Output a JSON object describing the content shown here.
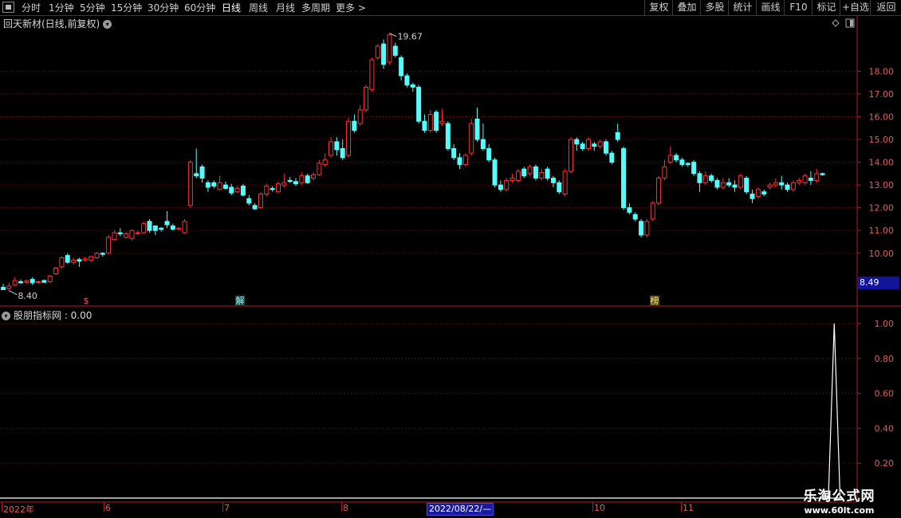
{
  "toolbar": {
    "left": [
      "分时",
      "1分钟",
      "5分钟",
      "15分钟",
      "30分钟",
      "60分钟",
      "日线",
      "周线",
      "月线",
      "多周期",
      "更多 >"
    ],
    "right": [
      "复权",
      "叠加",
      "多股",
      "统计",
      "画线",
      "F10",
      "标记",
      "+自选",
      "返回"
    ],
    "active": "日线"
  },
  "stock": {
    "title": "回天新材(日线,前复权)"
  },
  "indicator": {
    "title": "股朋指标网 : 0.00"
  },
  "price_axis": [
    "18.00",
    "17.00",
    "16.00",
    "15.00",
    "14.00",
    "13.00",
    "12.00",
    "11.00",
    "10.00"
  ],
  "indicator_axis": [
    "1.00",
    "0.80",
    "0.60",
    "0.40",
    "0.20"
  ],
  "current_price": "8.49",
  "max_label": "19.67",
  "min_label": "8.40",
  "markers": [
    "$",
    "解",
    "榜"
  ],
  "date_axis": [
    "2022年",
    "6",
    "7",
    "8",
    "10",
    "11"
  ],
  "cursor_date": "2022/08/22/—",
  "watermark": {
    "name": "乐淘公式网",
    "url": "www.60lt.com"
  },
  "colors": {
    "up": "#ff3232",
    "down": "#54fcfc",
    "grid": "#7a1010",
    "border": "#b01e1e",
    "axis_text": "#e0605a"
  },
  "chart_data": {
    "type": "candlestick",
    "ylim": [
      8.1,
      19.8
    ],
    "indicator_ylim": [
      0,
      1
    ],
    "candles": [
      [
        8.5,
        8.4,
        8.4,
        8.65
      ],
      [
        8.45,
        8.55,
        8.35,
        8.7
      ],
      [
        8.6,
        8.8,
        8.55,
        8.95
      ],
      [
        8.75,
        8.7,
        8.65,
        8.85
      ],
      [
        8.72,
        8.78,
        8.65,
        8.85
      ],
      [
        8.85,
        8.7,
        8.6,
        8.95
      ],
      [
        8.72,
        8.75,
        8.65,
        8.8
      ],
      [
        8.8,
        8.72,
        8.7,
        8.85
      ],
      [
        8.75,
        9.0,
        8.7,
        9.05
      ],
      [
        9.1,
        9.35,
        9.05,
        9.4
      ],
      [
        9.4,
        9.8,
        9.3,
        9.85
      ],
      [
        9.9,
        9.6,
        9.55,
        10.0
      ],
      [
        9.6,
        9.7,
        9.5,
        9.8
      ],
      [
        9.72,
        9.65,
        9.4,
        9.8
      ],
      [
        9.7,
        9.75,
        9.65,
        9.85
      ],
      [
        9.7,
        9.85,
        9.6,
        9.9
      ],
      [
        9.8,
        10.0,
        9.75,
        10.05
      ],
      [
        10.0,
        9.95,
        9.85,
        10.05
      ],
      [
        10.0,
        10.7,
        9.95,
        10.8
      ],
      [
        10.6,
        10.9,
        10.55,
        11.0
      ],
      [
        10.9,
        10.85,
        10.75,
        11.1
      ],
      [
        10.7,
        10.85,
        10.65,
        10.95
      ],
      [
        10.65,
        11.0,
        10.55,
        11.05
      ],
      [
        10.9,
        10.9,
        10.8,
        11.0
      ],
      [
        10.9,
        11.3,
        10.85,
        11.4
      ],
      [
        11.4,
        11.0,
        10.9,
        11.5
      ],
      [
        11.2,
        11.0,
        10.8,
        11.2
      ],
      [
        11.1,
        11.05,
        10.95,
        11.15
      ],
      [
        11.4,
        11.25,
        11.1,
        11.85
      ],
      [
        11.2,
        11.05,
        11.0,
        11.3
      ],
      [
        11.05,
        11.1,
        11.0,
        11.15
      ],
      [
        10.9,
        11.4,
        10.85,
        11.5
      ],
      [
        12.1,
        14.0,
        12.0,
        14.1
      ],
      [
        13.5,
        13.4,
        13.3,
        14.6
      ],
      [
        13.8,
        13.3,
        13.1,
        13.9
      ],
      [
        13.1,
        12.9,
        12.7,
        13.2
      ],
      [
        13.1,
        12.95,
        12.85,
        13.2
      ],
      [
        12.8,
        13.1,
        12.75,
        13.4
      ],
      [
        13.0,
        12.85,
        12.8,
        13.15
      ],
      [
        12.9,
        12.65,
        12.55,
        13.05
      ],
      [
        12.7,
        12.85,
        12.65,
        12.95
      ],
      [
        12.95,
        12.55,
        12.5,
        13.05
      ],
      [
        12.4,
        12.2,
        12.1,
        12.55
      ],
      [
        12.1,
        11.95,
        11.9,
        12.2
      ],
      [
        12.0,
        12.6,
        11.95,
        12.7
      ],
      [
        12.6,
        12.95,
        12.5,
        13.05
      ],
      [
        12.85,
        12.8,
        12.7,
        12.95
      ],
      [
        12.7,
        13.05,
        12.65,
        13.15
      ],
      [
        13.0,
        13.1,
        12.9,
        13.5
      ],
      [
        13.2,
        13.15,
        13.1,
        13.35
      ],
      [
        13.15,
        13.05,
        12.95,
        13.3
      ],
      [
        13.1,
        13.4,
        13.0,
        13.55
      ],
      [
        13.4,
        13.1,
        13.05,
        13.5
      ],
      [
        13.3,
        13.45,
        13.2,
        13.55
      ],
      [
        13.45,
        13.95,
        13.4,
        14.1
      ],
      [
        13.9,
        14.1,
        13.8,
        14.4
      ],
      [
        14.3,
        14.9,
        14.2,
        15.1
      ],
      [
        14.9,
        14.55,
        14.3,
        15.1
      ],
      [
        14.6,
        14.2,
        14.1,
        15.0
      ],
      [
        14.3,
        15.8,
        14.2,
        15.95
      ],
      [
        15.8,
        15.4,
        15.3,
        16.1
      ],
      [
        15.7,
        16.3,
        15.6,
        16.5
      ],
      [
        16.3,
        17.3,
        16.2,
        17.4
      ],
      [
        17.2,
        18.5,
        17.1,
        18.6
      ],
      [
        18.6,
        19.1,
        18.5,
        19.2
      ],
      [
        19.2,
        18.3,
        18.1,
        19.4
      ],
      [
        18.4,
        19.6,
        18.3,
        19.67
      ],
      [
        19.1,
        18.7,
        18.6,
        19.25
      ],
      [
        18.6,
        17.8,
        17.6,
        18.7
      ],
      [
        17.8,
        17.4,
        17.3,
        17.9
      ],
      [
        17.4,
        17.3,
        17.1,
        17.5
      ],
      [
        17.3,
        15.8,
        15.7,
        17.4
      ],
      [
        15.8,
        15.4,
        15.3,
        16.1
      ],
      [
        15.4,
        16.1,
        15.3,
        16.3
      ],
      [
        16.2,
        15.4,
        15.3,
        16.3
      ],
      [
        15.7,
        15.8,
        15.6,
        16.35
      ],
      [
        15.7,
        14.6,
        14.5,
        15.8
      ],
      [
        14.6,
        14.2,
        14.1,
        14.8
      ],
      [
        14.2,
        13.9,
        13.7,
        14.4
      ],
      [
        13.9,
        14.3,
        13.8,
        14.4
      ],
      [
        14.4,
        15.7,
        14.3,
        15.9
      ],
      [
        15.9,
        15.0,
        14.9,
        16.4
      ],
      [
        15.0,
        14.6,
        14.5,
        15.7
      ],
      [
        14.6,
        14.1,
        14.0,
        14.8
      ],
      [
        14.1,
        13.0,
        12.9,
        14.2
      ],
      [
        13.0,
        12.8,
        12.7,
        13.2
      ],
      [
        12.8,
        13.2,
        12.7,
        13.3
      ],
      [
        13.2,
        13.3,
        13.1,
        13.5
      ],
      [
        13.2,
        13.6,
        13.1,
        13.7
      ],
      [
        13.7,
        13.4,
        13.3,
        13.8
      ],
      [
        13.5,
        13.8,
        13.4,
        13.9
      ],
      [
        13.8,
        13.3,
        13.2,
        13.9
      ],
      [
        13.3,
        13.55,
        13.2,
        13.7
      ],
      [
        13.7,
        13.3,
        13.2,
        13.8
      ],
      [
        13.3,
        13.1,
        12.9,
        13.4
      ],
      [
        13.1,
        12.7,
        12.6,
        13.2
      ],
      [
        12.6,
        13.6,
        12.5,
        13.7
      ],
      [
        13.6,
        15.0,
        13.5,
        15.1
      ],
      [
        15.0,
        14.8,
        14.5,
        15.1
      ],
      [
        14.8,
        14.6,
        14.5,
        14.9
      ],
      [
        14.6,
        15.0,
        14.5,
        15.1
      ],
      [
        14.8,
        14.7,
        14.5,
        14.9
      ],
      [
        14.7,
        14.9,
        14.6,
        15.0
      ],
      [
        14.9,
        14.4,
        14.3,
        15.0
      ],
      [
        14.4,
        14.0,
        13.9,
        14.5
      ],
      [
        15.3,
        15.0,
        14.9,
        15.7
      ],
      [
        14.6,
        12.0,
        11.9,
        14.7
      ],
      [
        12.0,
        11.8,
        11.7,
        12.2
      ],
      [
        11.7,
        11.5,
        11.4,
        11.8
      ],
      [
        11.4,
        10.8,
        10.7,
        11.5
      ],
      [
        10.8,
        11.4,
        10.7,
        11.5
      ],
      [
        11.5,
        12.2,
        11.4,
        12.3
      ],
      [
        12.2,
        13.3,
        12.1,
        13.4
      ],
      [
        13.3,
        13.8,
        13.2,
        14.1
      ],
      [
        14.0,
        14.3,
        13.9,
        14.7
      ],
      [
        14.3,
        14.1,
        14.0,
        14.4
      ],
      [
        14.1,
        13.9,
        13.8,
        14.2
      ],
      [
        13.95,
        13.9,
        13.8,
        14.0
      ],
      [
        14.0,
        13.5,
        13.4,
        14.1
      ],
      [
        13.5,
        13.1,
        12.7,
        13.6
      ],
      [
        13.1,
        13.4,
        13.0,
        13.6
      ],
      [
        13.4,
        13.2,
        13.1,
        13.5
      ],
      [
        13.2,
        12.9,
        12.8,
        13.3
      ],
      [
        12.9,
        13.1,
        12.8,
        13.3
      ],
      [
        13.1,
        13.0,
        12.9,
        13.3
      ],
      [
        13.0,
        12.9,
        12.7,
        13.2
      ],
      [
        12.9,
        13.4,
        12.8,
        13.5
      ],
      [
        13.3,
        12.7,
        12.6,
        13.4
      ],
      [
        12.6,
        12.4,
        12.2,
        12.8
      ],
      [
        12.5,
        12.8,
        12.4,
        12.9
      ],
      [
        12.7,
        12.6,
        12.5,
        12.8
      ],
      [
        12.9,
        13.0,
        12.8,
        13.1
      ],
      [
        13.0,
        13.1,
        12.9,
        13.3
      ],
      [
        13.1,
        13.0,
        12.8,
        13.4
      ],
      [
        13.0,
        12.8,
        12.7,
        13.1
      ],
      [
        12.8,
        13.1,
        12.7,
        13.2
      ],
      [
        13.1,
        13.2,
        13.0,
        13.3
      ],
      [
        13.1,
        13.4,
        13.0,
        13.5
      ],
      [
        13.3,
        13.2,
        13.0,
        13.6
      ],
      [
        13.2,
        13.5,
        13.1,
        13.7
      ],
      [
        13.5,
        13.45,
        13.4,
        13.55
      ]
    ],
    "indicator_series": [
      {
        "index": 141,
        "value": 0
      },
      {
        "index": 142,
        "value": 1
      },
      {
        "index": 143,
        "value": 0
      }
    ]
  }
}
